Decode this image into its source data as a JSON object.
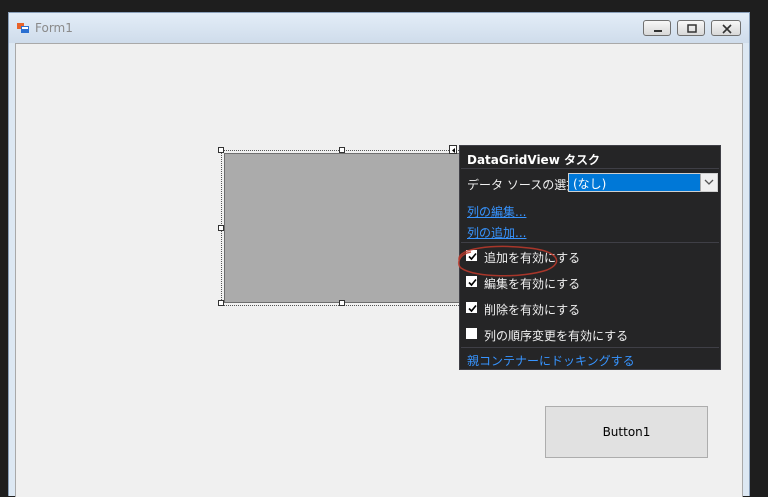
{
  "window": {
    "title": "Form1"
  },
  "panel": {
    "title": "DataGridView タスク",
    "data_source_label": "データ ソースの選択:",
    "data_source_value": "(なし)",
    "edit_columns_link": "列の編集...",
    "add_column_link": "列の追加...",
    "checkboxes": [
      {
        "label": "追加を有効にする",
        "checked": true
      },
      {
        "label": "編集を有効にする",
        "checked": true
      },
      {
        "label": "削除を有効にする",
        "checked": true
      },
      {
        "label": "列の順序変更を有効にする",
        "checked": false
      }
    ],
    "dock_link": "親コンテナーにドッキングする"
  },
  "form": {
    "button1_label": "Button1"
  },
  "colors": {
    "panel_bg": "#252526",
    "link": "#3794ff",
    "combo_selected": "#0078d7",
    "annotation": "#c0392b"
  }
}
